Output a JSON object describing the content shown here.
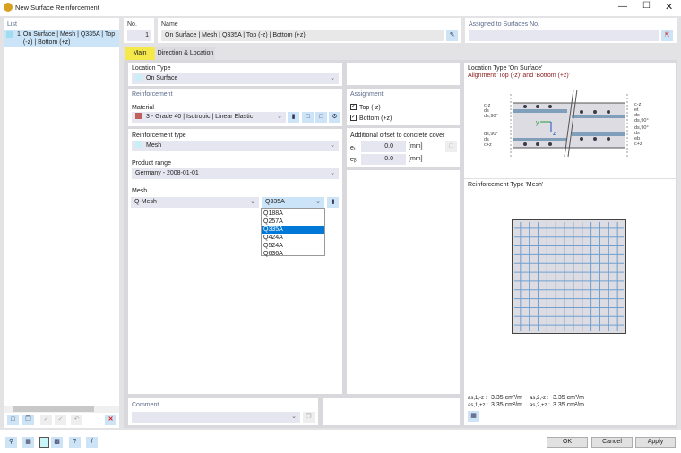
{
  "window": {
    "title": "New Surface Reinforcement"
  },
  "list": {
    "header": "List",
    "items": [
      {
        "no": "1",
        "label": "On Surface | Mesh | Q335A | Top (-z) | Bottom (+z)"
      }
    ]
  },
  "no": {
    "label": "No.",
    "value": "1"
  },
  "name": {
    "label": "Name",
    "value": "On Surface | Mesh | Q335A | Top (-z) | Bottom (+z)"
  },
  "assigned": {
    "label": "Assigned to Surfaces No.",
    "value": ""
  },
  "tabs": [
    {
      "label": "Main",
      "active": true
    },
    {
      "label": "Direction & Location",
      "active": false
    }
  ],
  "location_type": {
    "label": "Location Type",
    "value": "On Surface"
  },
  "reinforcement": {
    "header": "Reinforcement",
    "material_label": "Material",
    "material_value": "3 - Grade 40 | Isotropic | Linear Elastic",
    "material_color": "#c0605c"
  },
  "reinforcement_type": {
    "label": "Reinforcement type",
    "value": "Mesh"
  },
  "product_range": {
    "label": "Product range",
    "value": "Germany - 2008-01-01"
  },
  "mesh": {
    "label": "Mesh",
    "type_value": "Q-Mesh",
    "value": "Q335A",
    "options": [
      "Q188A",
      "Q257A",
      "Q335A",
      "Q424A",
      "Q524A",
      "Q636A"
    ],
    "selected": "Q335A"
  },
  "assignment": {
    "header": "Assignment",
    "top_label": "Top (-z)",
    "top_checked": true,
    "bottom_label": "Bottom (+z)",
    "bottom_checked": true
  },
  "offset": {
    "header": "Additional offset to concrete cover",
    "e_t_label": "eₜ",
    "e_t_value": "0.0",
    "e_b_label": "eᵦ",
    "e_b_value": "0.0",
    "unit": "[mm]"
  },
  "comment": {
    "label": "Comment",
    "value": ""
  },
  "preview": {
    "line1": "Location Type 'On Surface'",
    "line2": "Alignment 'Top (-z)' and 'Bottom (+z)'",
    "mesh_title": "Reinforcement Type 'Mesh'",
    "left_labels": [
      "c-z",
      "ds",
      "ds,90°",
      "ds,90°",
      "ds",
      "c+z"
    ],
    "right_labels": [
      "c-z",
      "et",
      "ds",
      "ds,90°",
      "ds,90°",
      "ds",
      "eb",
      "c+z"
    ],
    "results": [
      {
        "label": "as,1,-z :",
        "value": "3.35 cm²/m"
      },
      {
        "label": "as,2,-z :",
        "value": "3.35 cm²/m"
      },
      {
        "label": "as,1,+z :",
        "value": "3.35 cm²/m"
      },
      {
        "label": "as,2,+z :",
        "value": "3.35 cm²/m"
      }
    ]
  },
  "buttons": {
    "ok": "OK",
    "cancel": "Cancel",
    "apply": "Apply"
  }
}
